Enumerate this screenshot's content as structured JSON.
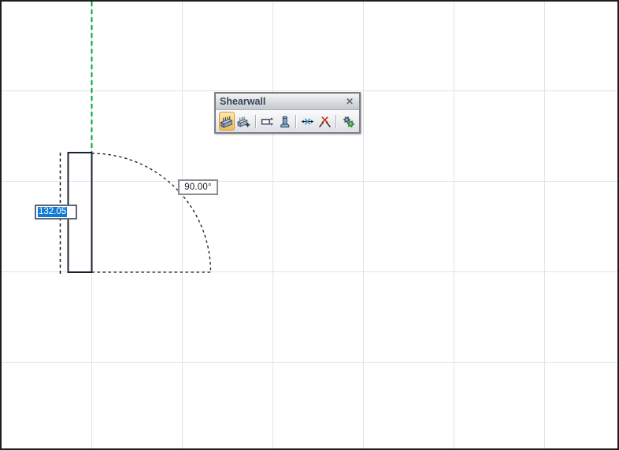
{
  "toolbar": {
    "title": "Shearwall",
    "close_glyph": "✕",
    "buttons": [
      {
        "icon": "draw-shearwall-icon",
        "active": true
      },
      {
        "icon": "add-shearwall-icon",
        "active": false
      },
      {
        "icon": "wall-opening-icon",
        "active": false
      },
      {
        "icon": "pedestal-icon",
        "active": false
      },
      {
        "icon": "snap-intersection-icon",
        "active": false
      },
      {
        "icon": "delete-wall-icon",
        "active": false
      },
      {
        "icon": "settings-gears-icon",
        "active": false
      }
    ]
  },
  "drawing": {
    "angle_label": "90.00°",
    "length_value": "132.05"
  },
  "colors": {
    "construction_green": "#00a62f",
    "selection_blue": "#0f7ad6",
    "active_button_amber": "#f7b951",
    "grid_line": "#e2e2eb",
    "wall_outline": "#1a212e"
  }
}
